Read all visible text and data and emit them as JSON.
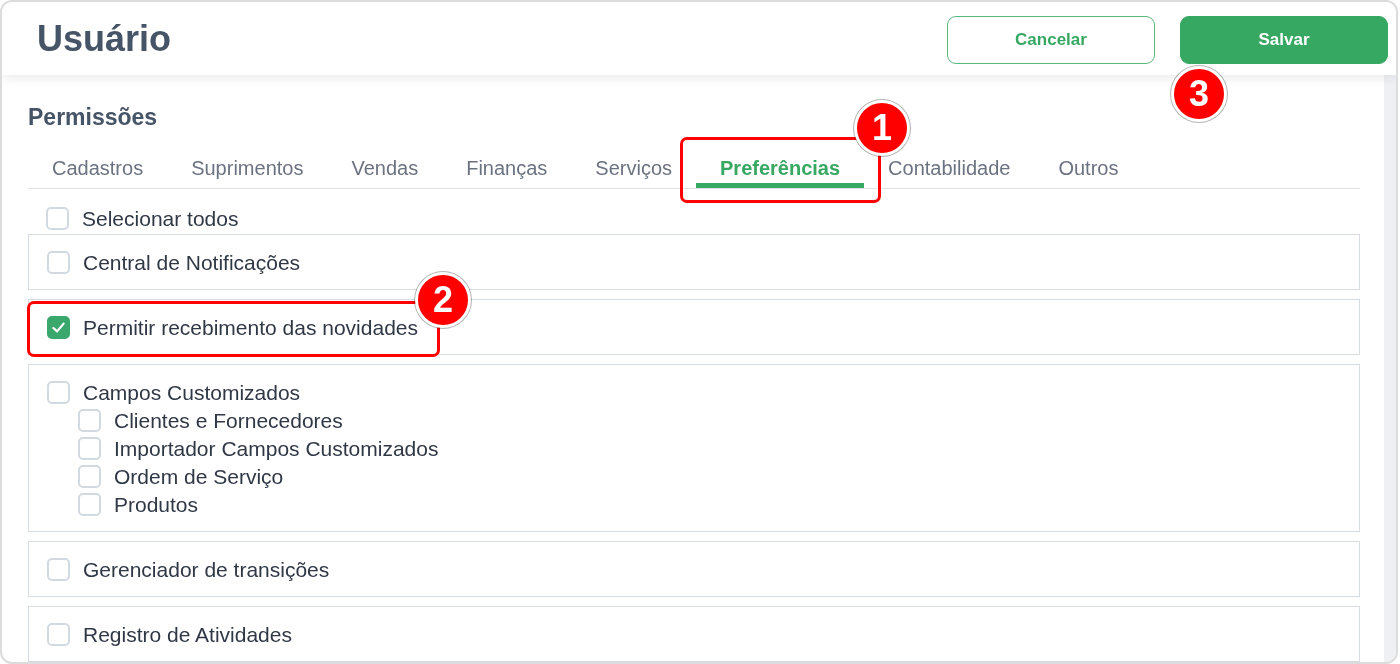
{
  "header": {
    "title": "Usuário",
    "buttons": [
      {
        "label": "Cancelar",
        "kind": "secondary"
      },
      {
        "label": "Salvar",
        "kind": "primary",
        "annotation": {
          "number": "3"
        }
      }
    ]
  },
  "section": {
    "title": "Permissões",
    "tabs": [
      {
        "label": "Cadastros",
        "selected": false
      },
      {
        "label": "Suprimentos",
        "selected": false
      },
      {
        "label": "Vendas",
        "selected": false
      },
      {
        "label": "Finanças",
        "selected": false
      },
      {
        "label": "Serviços",
        "selected": false
      },
      {
        "label": "Preferências",
        "selected": true,
        "annotation": {
          "number": "1",
          "framed": true
        }
      },
      {
        "label": "Contabilidade",
        "selected": false
      },
      {
        "label": "Outros",
        "selected": false
      }
    ],
    "select_all": {
      "label": "Selecionar todos",
      "checked": false
    },
    "groups": [
      {
        "label": "Central de Notificações",
        "checked": false
      },
      {
        "label": "Permitir recebimento das novidades",
        "checked": true,
        "annotation": {
          "number": "2",
          "framed": true
        }
      },
      {
        "label": "Campos Customizados",
        "checked": false,
        "children": [
          {
            "label": "Clientes e Fornecedores",
            "checked": false
          },
          {
            "label": "Importador Campos Customizados",
            "checked": false
          },
          {
            "label": "Ordem de Serviço",
            "checked": false
          },
          {
            "label": "Produtos",
            "checked": false
          }
        ]
      },
      {
        "label": "Gerenciador de transições",
        "checked": false
      },
      {
        "label": "Registro de Atividades",
        "checked": false
      }
    ]
  }
}
